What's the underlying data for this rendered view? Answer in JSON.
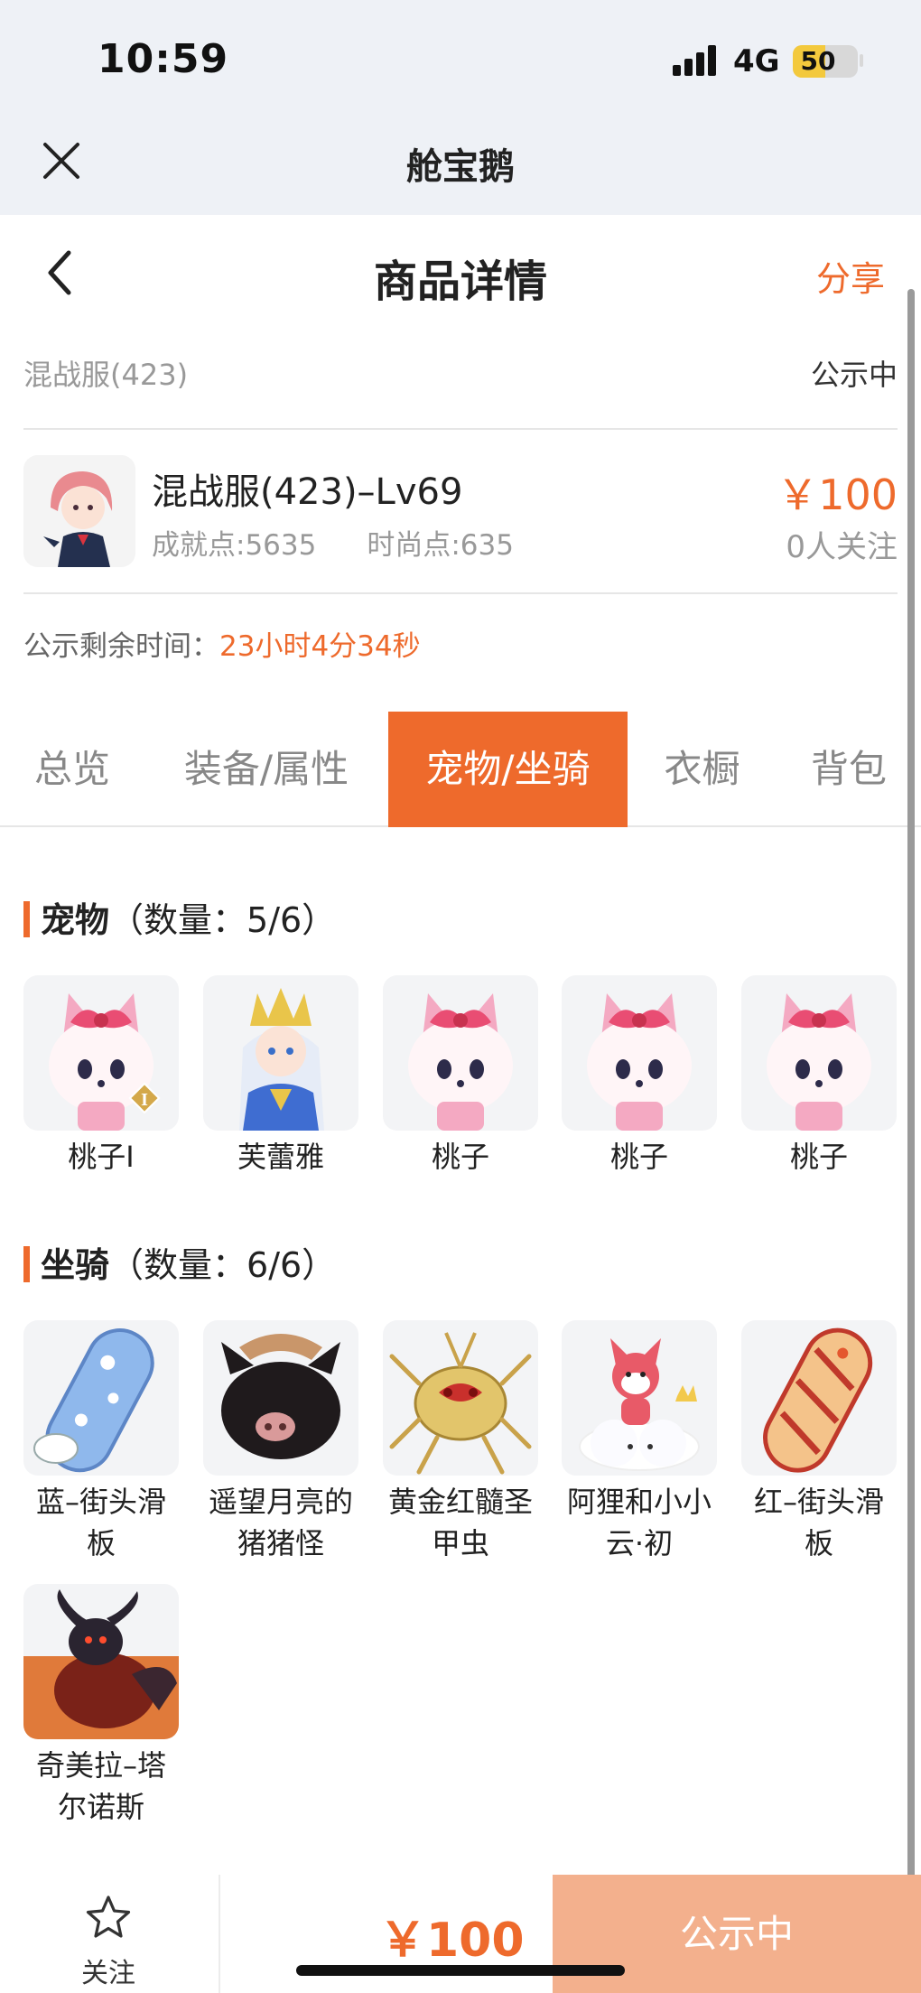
{
  "status_bar": {
    "time": "10:59",
    "network": "4G",
    "battery": "50",
    "battery_level": 0.5
  },
  "app": {
    "title": "舱宝鹅"
  },
  "nav": {
    "title": "商品详情",
    "share": "分享"
  },
  "server": {
    "name": "混战服(423)",
    "status": "公示中"
  },
  "item": {
    "name": "混战服(423)–Lv69",
    "achievement": "成就点:5635",
    "fashion": "时尚点:635",
    "price": "￥100",
    "followers": "0人关注"
  },
  "timer": {
    "label": "公示剩余时间：",
    "value": "23小时4分34秒"
  },
  "tabs": [
    "总览",
    "装备/属性",
    "宠物/坐骑",
    "衣橱",
    "背包"
  ],
  "active_tab": "宠物/坐骑",
  "pets": {
    "title": "宠物",
    "count": "（数量：5/6）",
    "items": [
      "桃子I",
      "芙蕾雅",
      "桃子",
      "桃子",
      "桃子"
    ]
  },
  "mounts": {
    "title": "坐骑",
    "count": "（数量：6/6）",
    "items": [
      "蓝–街头滑板",
      "遥望月亮的猪猪怪",
      "黄金红髓圣甲虫",
      "阿狸和小小云·初",
      "红–街头滑板",
      "奇美拉–塔尔诺斯"
    ]
  },
  "bottom": {
    "follow": "关注",
    "price": "￥100",
    "cta": "公示中"
  },
  "colors": {
    "accent": "#ee6a2c",
    "cta": "#f3b08d",
    "header_bg": "#eef1f6"
  },
  "icons": {
    "close": "close-icon",
    "back": "back-arrow-icon",
    "follow": "star-icon"
  }
}
